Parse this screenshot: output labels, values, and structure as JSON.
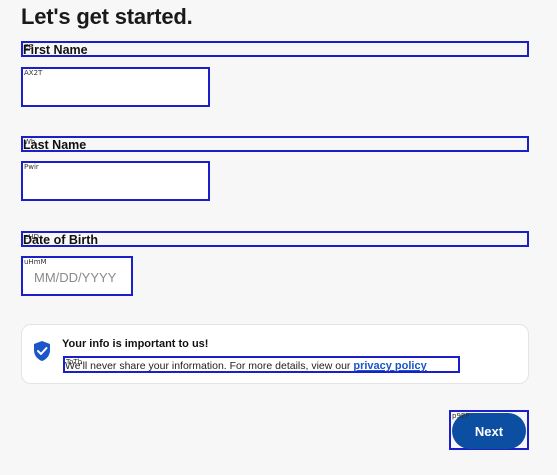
{
  "page": {
    "title": "Let's get started."
  },
  "form": {
    "first_name": {
      "label": "First Name",
      "label_tag": "ZB",
      "input_tag": "AX2T",
      "value": "",
      "placeholder": ""
    },
    "last_name": {
      "label": "Last Name",
      "label_tag": "Wh",
      "input_tag": "Pwir",
      "value": "",
      "placeholder": ""
    },
    "dob": {
      "label": "Date of Birth",
      "label_tag": "eHD",
      "input_tag": "uHmM",
      "value": "",
      "placeholder": "MM/DD/YYYY"
    }
  },
  "info": {
    "title": "Your info is important to us!",
    "body": "We'll never share your information. For more details, view our ",
    "link": "privacy policy",
    "tag": "ToTb",
    "icon": "shield-check-icon",
    "icon_color": "#1a55c9"
  },
  "actions": {
    "next_label": "Next",
    "next_tag": "p9EP",
    "next_color": "#0b4ea2"
  },
  "colors": {
    "annotation_box": "#1a1fc9",
    "background": "#f7f7f7"
  }
}
